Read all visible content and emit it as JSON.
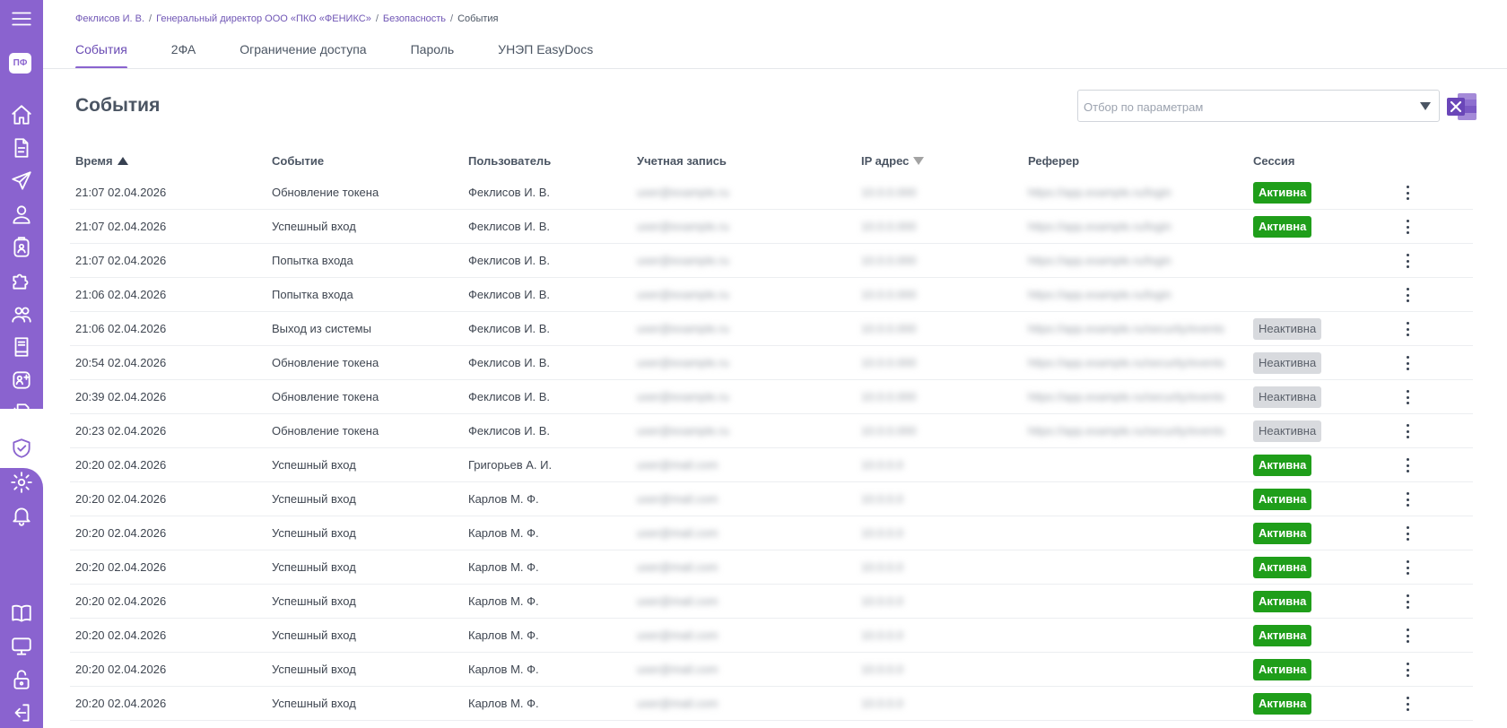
{
  "sidebar": {
    "logo": "ПФ",
    "top_icons": [
      "menu-icon",
      "logo",
      "home-icon",
      "document-icon",
      "send-icon",
      "user-icon",
      "contact-icon",
      "puzzle-icon",
      "users-icon",
      "book-icon",
      "add-user-icon",
      "documents-icon",
      "shield-check-icon",
      "gear-icon",
      "bell-icon"
    ],
    "bottom_icons": [
      "open-book-icon",
      "monitor-icon",
      "unlock-icon",
      "logout-icon"
    ],
    "active": "shield-check-icon",
    "color": "#8a63cf"
  },
  "breadcrumb": {
    "items": [
      "Феклисов И. В.",
      "Генеральный директор ООО «ПКО «ФЕНИКС»",
      "Безопасность",
      "События"
    ],
    "separator": "/"
  },
  "tabs": [
    {
      "label": "События",
      "active": true
    },
    {
      "label": "2ФА",
      "active": false
    },
    {
      "label": "Ограничение доступа",
      "active": false
    },
    {
      "label": "Пароль",
      "active": false
    },
    {
      "label": "УНЭП EasyDocs",
      "active": false
    }
  ],
  "page": {
    "title": "События",
    "filter_placeholder": "Отбор по параметрам",
    "export_icon": "excel-icon"
  },
  "table": {
    "columns": {
      "time": "Время",
      "event": "Событие",
      "user": "Пользователь",
      "account": "Учетная запись",
      "ip": "IP адрес",
      "referer": "Реферер",
      "session": "Сессия"
    },
    "rows": [
      {
        "time": "21:07 02.04.2026",
        "event": "Обновление токена",
        "user": "Феклисов И. В.",
        "account": "user@example.ru",
        "ip": "10.0.0.000",
        "referer": "https://app.example.ru/login",
        "session": "Активна"
      },
      {
        "time": "21:07 02.04.2026",
        "event": "Успешный вход",
        "user": "Феклисов И. В.",
        "account": "user@example.ru",
        "ip": "10.0.0.000",
        "referer": "https://app.example.ru/login",
        "session": "Активна"
      },
      {
        "time": "21:07 02.04.2026",
        "event": "Попытка входа",
        "user": "Феклисов И. В.",
        "account": "user@example.ru",
        "ip": "10.0.0.000",
        "referer": "https://app.example.ru/login",
        "session": ""
      },
      {
        "time": "21:06 02.04.2026",
        "event": "Попытка входа",
        "user": "Феклисов И. В.",
        "account": "user@example.ru",
        "ip": "10.0.0.000",
        "referer": "https://app.example.ru/login",
        "session": ""
      },
      {
        "time": "21:06 02.04.2026",
        "event": "Выход из системы",
        "user": "Феклисов И. В.",
        "account": "user@example.ru",
        "ip": "10.0.0.000",
        "referer": "https://app.example.ru/security/events",
        "session": "Неактивна"
      },
      {
        "time": "20:54 02.04.2026",
        "event": "Обновление токена",
        "user": "Феклисов И. В.",
        "account": "user@example.ru",
        "ip": "10.0.0.000",
        "referer": "https://app.example.ru/security/events",
        "session": "Неактивна"
      },
      {
        "time": "20:39 02.04.2026",
        "event": "Обновление токена",
        "user": "Феклисов И. В.",
        "account": "user@example.ru",
        "ip": "10.0.0.000",
        "referer": "https://app.example.ru/security/events",
        "session": "Неактивна"
      },
      {
        "time": "20:23 02.04.2026",
        "event": "Обновление токена",
        "user": "Феклисов И. В.",
        "account": "user@example.ru",
        "ip": "10.0.0.000",
        "referer": "https://app.example.ru/security/events",
        "session": "Неактивна"
      },
      {
        "time": "20:20 02.04.2026",
        "event": "Успешный вход",
        "user": "Григорьев А. И.",
        "account": "user@mail.com",
        "ip": "10.0.0.0",
        "referer": "",
        "session": "Активна"
      },
      {
        "time": "20:20 02.04.2026",
        "event": "Успешный вход",
        "user": "Карлов М. Ф.",
        "account": "user@mail.com",
        "ip": "10.0.0.0",
        "referer": "",
        "session": "Активна"
      },
      {
        "time": "20:20 02.04.2026",
        "event": "Успешный вход",
        "user": "Карлов М. Ф.",
        "account": "user@mail.com",
        "ip": "10.0.0.0",
        "referer": "",
        "session": "Активна"
      },
      {
        "time": "20:20 02.04.2026",
        "event": "Успешный вход",
        "user": "Карлов М. Ф.",
        "account": "user@mail.com",
        "ip": "10.0.0.0",
        "referer": "",
        "session": "Активна"
      },
      {
        "time": "20:20 02.04.2026",
        "event": "Успешный вход",
        "user": "Карлов М. Ф.",
        "account": "user@mail.com",
        "ip": "10.0.0.0",
        "referer": "",
        "session": "Активна"
      },
      {
        "time": "20:20 02.04.2026",
        "event": "Успешный вход",
        "user": "Карлов М. Ф.",
        "account": "user@mail.com",
        "ip": "10.0.0.0",
        "referer": "",
        "session": "Активна"
      },
      {
        "time": "20:20 02.04.2026",
        "event": "Успешный вход",
        "user": "Карлов М. Ф.",
        "account": "user@mail.com",
        "ip": "10.0.0.0",
        "referer": "",
        "session": "Активна"
      },
      {
        "time": "20:20 02.04.2026",
        "event": "Успешный вход",
        "user": "Карлов М. Ф.",
        "account": "user@mail.com",
        "ip": "10.0.0.0",
        "referer": "",
        "session": "Активна"
      }
    ]
  },
  "colors": {
    "accent": "#8a63cf",
    "active_badge": "#1f9e1a",
    "inactive_badge": "#d8dade"
  }
}
